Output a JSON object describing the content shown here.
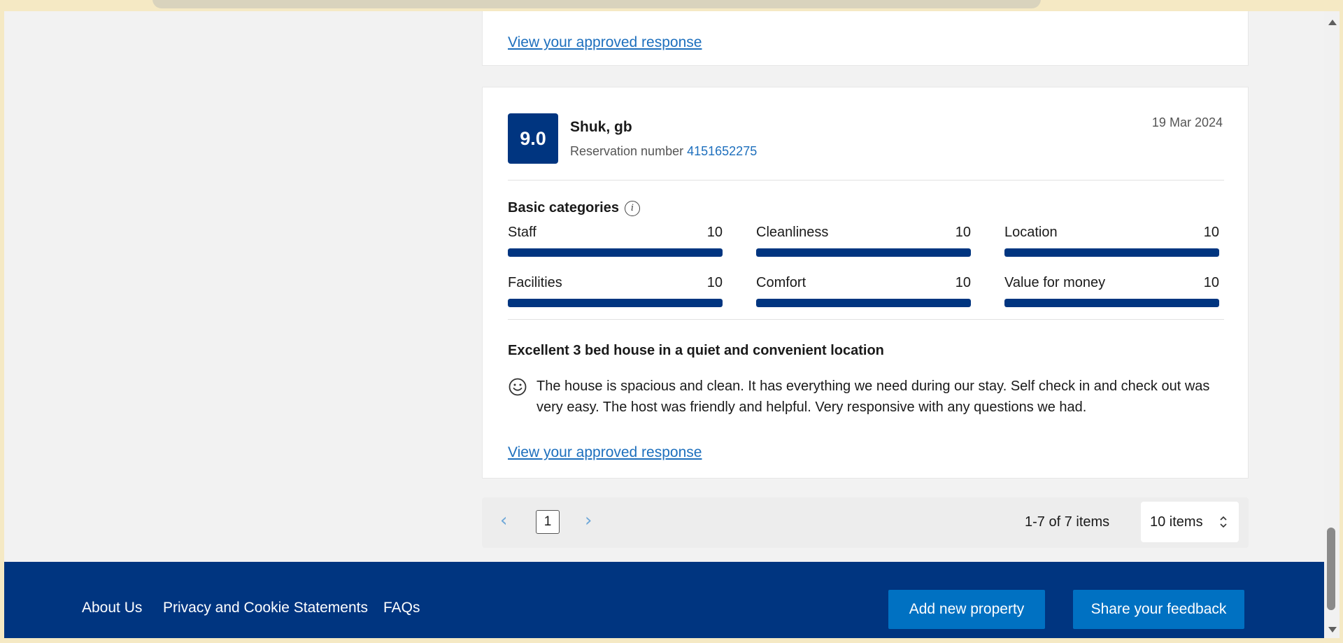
{
  "review_top": {
    "link_text": "View your approved response"
  },
  "review": {
    "score": "9.0",
    "reviewer": "Shuk, gb",
    "reservation_label": "Reservation number",
    "reservation_number": "4151652275",
    "date": "19 Mar 2024",
    "categories_heading": "Basic categories",
    "categories": [
      {
        "label": "Staff",
        "score": "10",
        "fraction": 1.0
      },
      {
        "label": "Cleanliness",
        "score": "10",
        "fraction": 1.0
      },
      {
        "label": "Location",
        "score": "10",
        "fraction": 1.0
      },
      {
        "label": "Facilities",
        "score": "10",
        "fraction": 1.0
      },
      {
        "label": "Comfort",
        "score": "10",
        "fraction": 1.0
      },
      {
        "label": "Value for money",
        "score": "10",
        "fraction": 1.0
      }
    ],
    "title": "Excellent 3 bed house in a quiet and convenient location",
    "text": "The house is spacious and clean. It has everything we need during our stay. Self check in and check out was very easy. The host was friendly and helpful. Very responsive with any questions we had.",
    "link_text": "View your approved response"
  },
  "pagination": {
    "prev": "‹",
    "current_page": "1",
    "next": "›",
    "items_count": "1-7 of 7 items",
    "page_size": "10 items"
  },
  "footer": {
    "about": "About Us",
    "privacy": "Privacy and Cookie Statements",
    "faq": "FAQs",
    "add_property": "Add new property",
    "feedback": "Share your feedback"
  },
  "colors": {
    "brand_dark": "#003580",
    "brand_button": "#0071c2",
    "link": "#1d6fbd"
  }
}
